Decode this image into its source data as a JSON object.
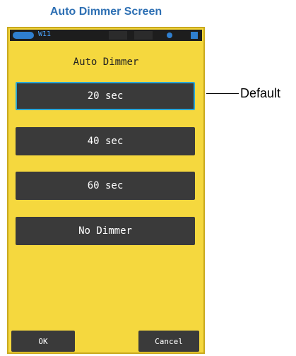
{
  "header": {
    "title": "Auto Dimmer Screen"
  },
  "status": {
    "text": "W11"
  },
  "screen": {
    "title": "Auto Dimmer",
    "options": [
      {
        "label": "20 sec",
        "selected": true
      },
      {
        "label": "40 sec",
        "selected": false
      },
      {
        "label": "60 sec",
        "selected": false
      },
      {
        "label": "No Dimmer",
        "selected": false
      }
    ],
    "ok_label": "OK",
    "cancel_label": "Cancel"
  },
  "annotation": {
    "default_label": "Default"
  },
  "colors": {
    "screen_bg": "#f5d83e",
    "button_bg": "#3a3a3a",
    "selection_border": "#2aa7d6",
    "title_color": "#2d6fb3"
  }
}
